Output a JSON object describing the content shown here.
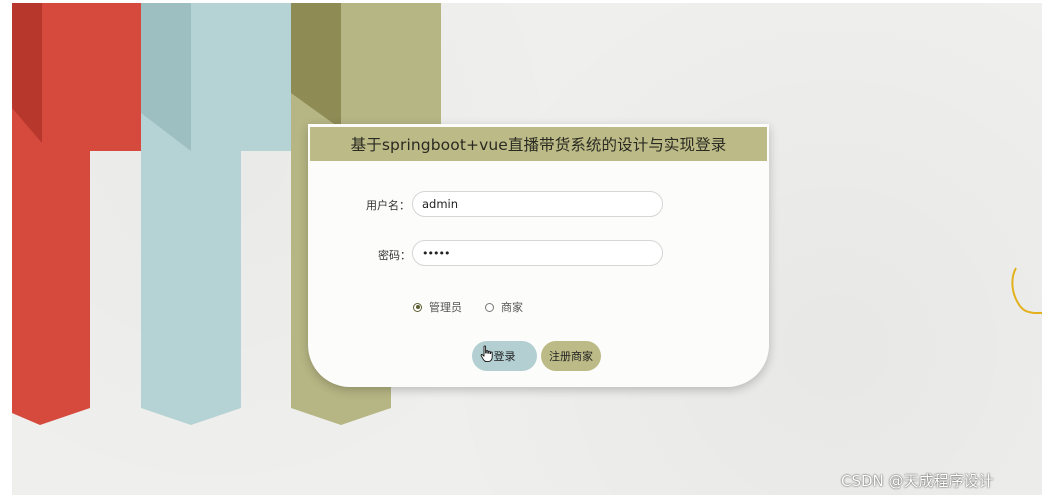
{
  "colors": {
    "red": "#d64a3e",
    "red_dark": "#b7372c",
    "teal": "#b5d2d4",
    "teal_dark": "#9dbfc2",
    "olive": "#b6b684",
    "olive_dark": "#8e8b55",
    "header": "#bcbb87",
    "login_button": "#b3cfd2",
    "register_button": "#bcbb87"
  },
  "login": {
    "title": "基于springboot+vue直播带货系统的设计与实现登录",
    "username_label": "用户名：",
    "username_value": "admin",
    "password_label": "密码：",
    "password_value": "•••••",
    "roles": [
      {
        "label": "管理员",
        "selected": true
      },
      {
        "label": "商家",
        "selected": false
      }
    ],
    "login_button": "登录",
    "register_button": "注册商家"
  },
  "watermark": "CSDN @天成程序设计"
}
